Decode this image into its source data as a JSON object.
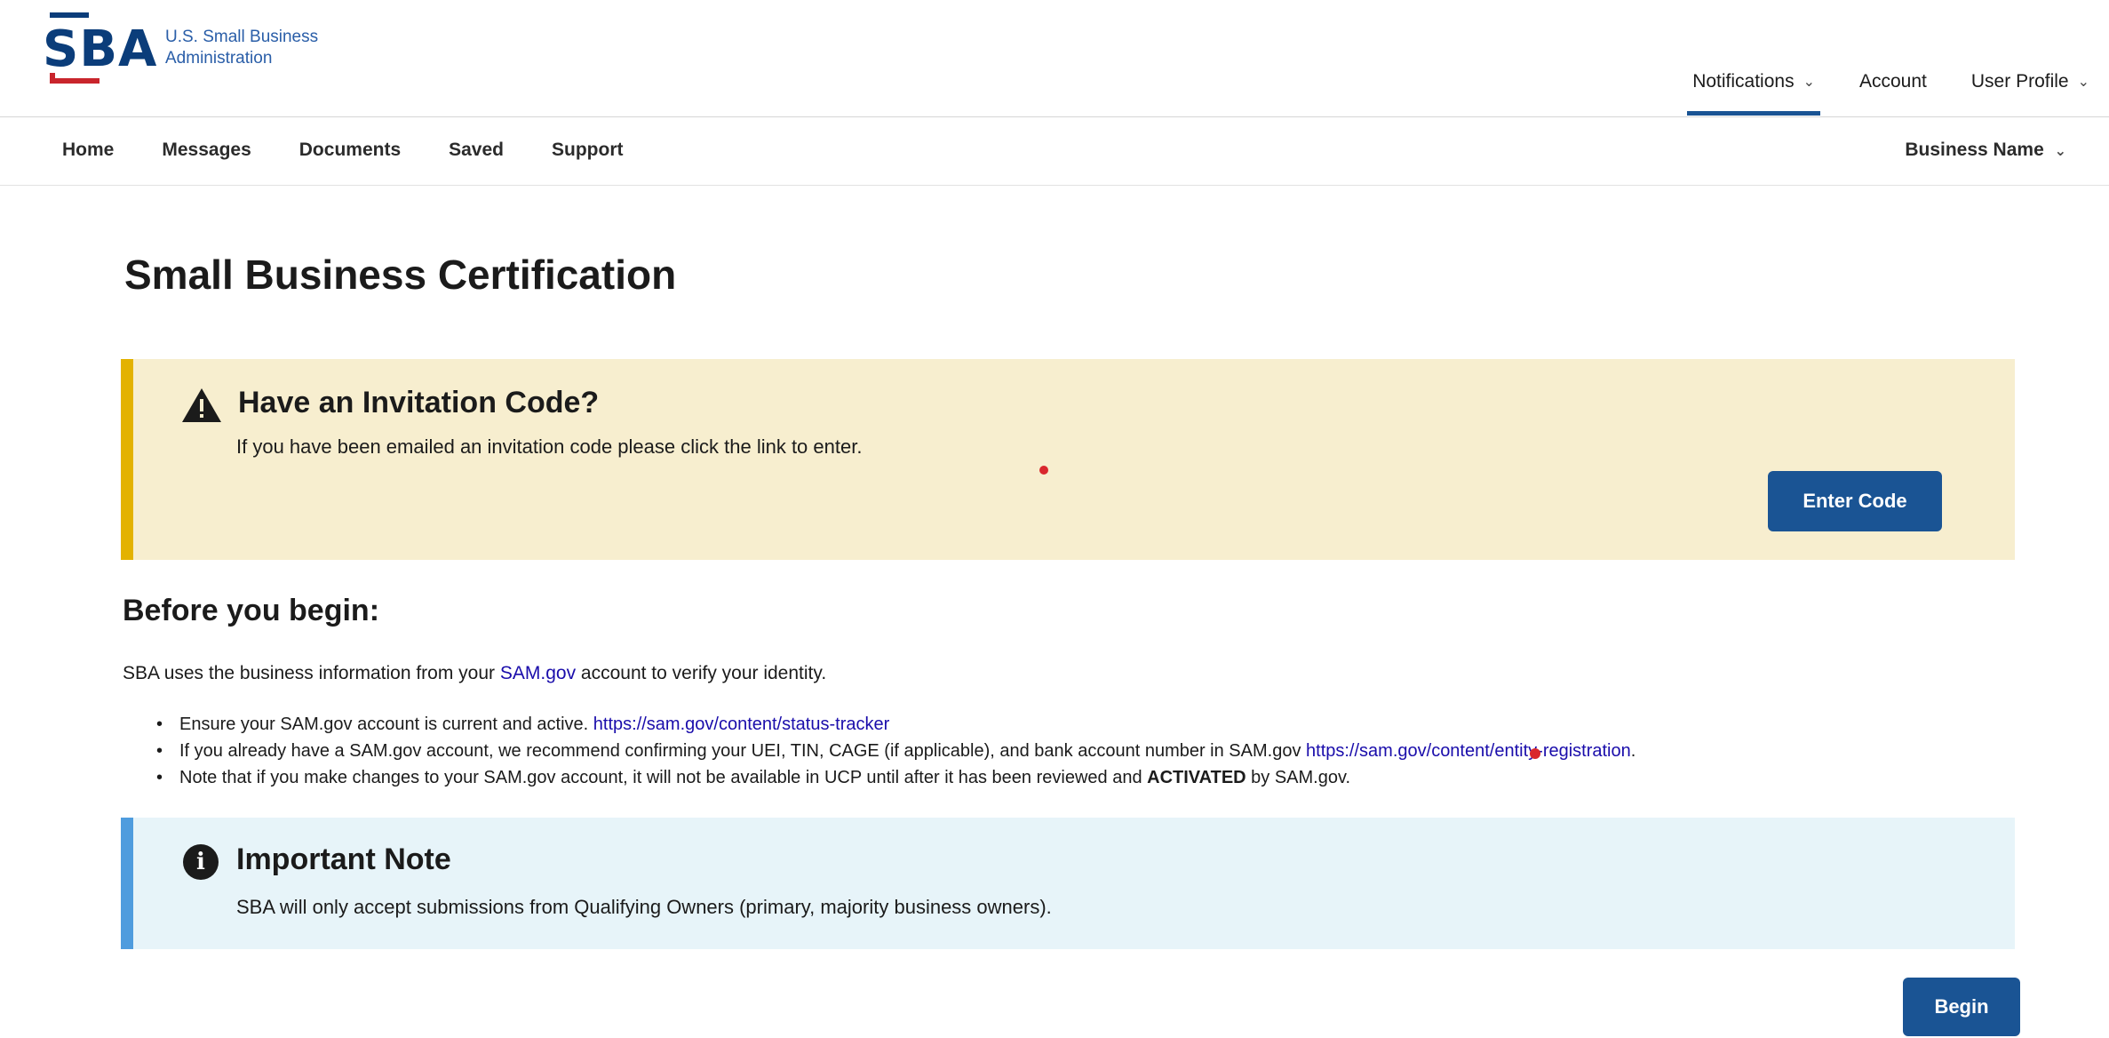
{
  "header": {
    "logo_letters": "SBA",
    "agency_line1": "U.S. Small Business",
    "agency_line2": "Administration",
    "nav": [
      {
        "label": "Notifications",
        "has_dropdown": true,
        "active": true
      },
      {
        "label": "Account",
        "has_dropdown": false
      },
      {
        "label": "User Profile",
        "has_dropdown": true
      }
    ]
  },
  "subnav": {
    "links": [
      "Home",
      "Messages",
      "Documents",
      "Saved",
      "Support"
    ],
    "business_label": "Business Name"
  },
  "main": {
    "title": "Small Business Certification",
    "invite_alert": {
      "icon": "warning-icon",
      "heading": "Have an Invitation Code?",
      "text": "If you have been emailed an invitation code please click the link to enter.",
      "button": "Enter Code"
    },
    "before": {
      "heading": "Before you begin:",
      "intro_prefix": "SBA uses the business information from your ",
      "intro_link": "SAM.gov",
      "intro_suffix": " account to verify your identity.",
      "bullets": [
        {
          "text": "Ensure your SAM.gov account is current and active. ",
          "link": "https://sam.gov/content/status-tracker"
        },
        {
          "text": "If you already have a SAM.gov account, we recommend confirming your UEI, TIN, CAGE (if applicable), and bank account number in SAM.gov ",
          "link": "https://sam.gov/content/entity-registration",
          "suffix": "."
        },
        {
          "text": "Note that if you make changes to your SAM.gov account, it will not be available in UCP until after it has been reviewed and ",
          "bold": "ACTIVATED",
          "suffix": " by SAM.gov."
        }
      ]
    },
    "note_alert": {
      "icon": "info-icon",
      "icon_glyph": "i",
      "heading": "Important Note",
      "text": "SBA will only accept submissions from Qualifying Owners (primary, majority business owners)."
    },
    "begin_button": "Begin"
  },
  "colors": {
    "primary": "#1a5494",
    "warning_bg": "#f7eecf",
    "warning_border": "#e3b200",
    "info_bg": "#e7f4f9",
    "info_border": "#4f9cde",
    "sba_blue": "#0b3d7a",
    "sba_red": "#c9252c"
  }
}
